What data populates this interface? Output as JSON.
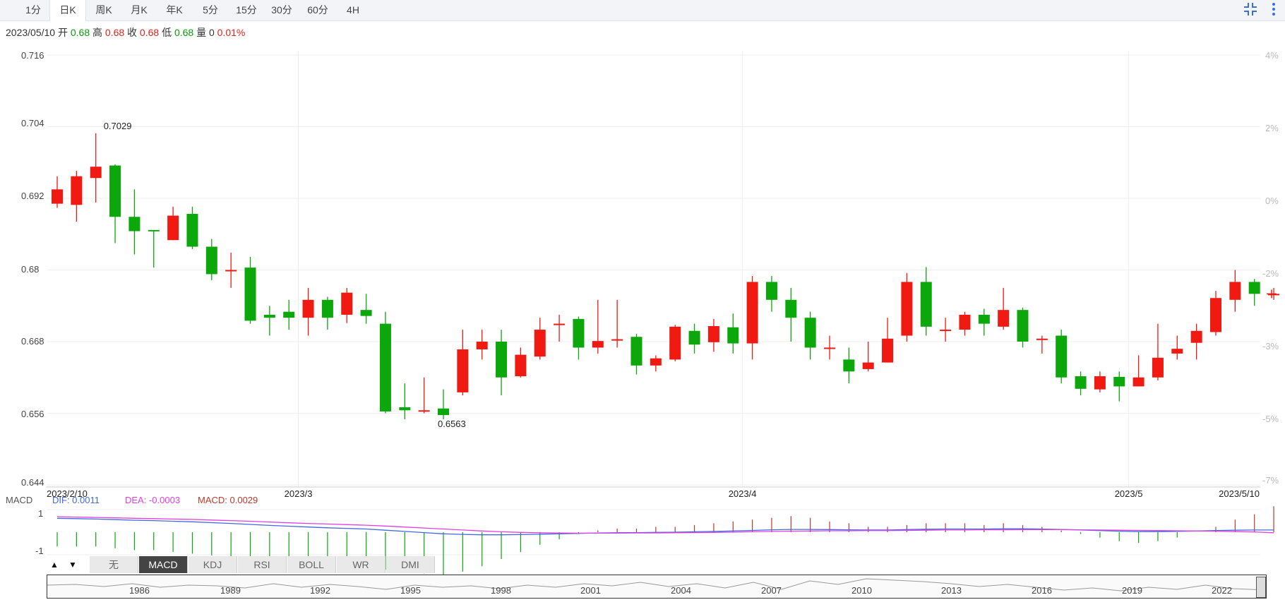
{
  "tabs": [
    "1分",
    "日K",
    "周K",
    "月K",
    "年K",
    "5分",
    "15分",
    "30分",
    "60分",
    "4H"
  ],
  "active_tab": "日K",
  "toolbar_icons": [
    "collapse-icon",
    "more-icon"
  ],
  "ohlc_info": {
    "date": "2023/05/10",
    "open_label": "开",
    "open": "0.68",
    "high_label": "高",
    "high": "0.68",
    "close_label": "收",
    "close": "0.68",
    "low_label": "低",
    "low": "0.68",
    "volume_label": "量",
    "volume": "0",
    "change": "0.01%"
  },
  "colors": {
    "up": "#f01a12",
    "down": "#0ba70b",
    "dif": "#4169e1",
    "dea": "#e040e0",
    "macd": "#c0392b",
    "grid": "#eeeeee"
  },
  "chart_data": {
    "type": "candlestick",
    "y_ticks": [
      "0.716",
      "0.704",
      "0.692",
      "0.68",
      "0.668",
      "0.656",
      "0.644"
    ],
    "pct_ticks": [
      "4%",
      "2%",
      "0%",
      "-2%",
      "-3%",
      "-5%",
      "-7%"
    ],
    "ylim": [
      0.644,
      0.716
    ],
    "x_labels": [
      {
        "index": 0,
        "label": "2023/2/10"
      },
      {
        "index": 13,
        "label": "2023/3"
      },
      {
        "index": 36,
        "label": "2023/4"
      },
      {
        "index": 56,
        "label": "2023/5"
      },
      {
        "index": 63,
        "label": "2023/5/10"
      }
    ],
    "annotations": [
      {
        "index": 2,
        "value": 0.7029,
        "label": "0.7029"
      },
      {
        "index": 20,
        "value": 0.6563,
        "label": "0.6563"
      }
    ],
    "candles": [
      [
        0.6911,
        0.6935,
        0.6957,
        0.6904
      ],
      [
        0.6909,
        0.6957,
        0.6966,
        0.6881
      ],
      [
        0.6954,
        0.6973,
        0.7029,
        0.6913
      ],
      [
        0.6975,
        0.6889,
        0.6977,
        0.6845
      ],
      [
        0.6889,
        0.6865,
        0.6935,
        0.6826
      ],
      [
        0.6867,
        0.6866,
        0.6866,
        0.6804
      ],
      [
        0.685,
        0.6891,
        0.6906,
        0.685
      ],
      [
        0.6894,
        0.6839,
        0.6906,
        0.6835
      ],
      [
        0.6839,
        0.6793,
        0.6852,
        0.6783
      ],
      [
        0.68,
        0.68,
        0.6829,
        0.677
      ],
      [
        0.6804,
        0.6715,
        0.6822,
        0.671
      ],
      [
        0.6725,
        0.672,
        0.674,
        0.669
      ],
      [
        0.673,
        0.672,
        0.675,
        0.67
      ],
      [
        0.672,
        0.675,
        0.677,
        0.669
      ],
      [
        0.675,
        0.672,
        0.6755,
        0.67
      ],
      [
        0.6725,
        0.6762,
        0.677,
        0.6711
      ],
      [
        0.6733,
        0.6723,
        0.676,
        0.671
      ],
      [
        0.671,
        0.6563,
        0.673,
        0.656
      ],
      [
        0.657,
        0.6565,
        0.661,
        0.655
      ],
      [
        0.6565,
        0.6565,
        0.662,
        0.656
      ],
      [
        0.6568,
        0.6557,
        0.66,
        0.655
      ],
      [
        0.6595,
        0.6667,
        0.67,
        0.659
      ],
      [
        0.6667,
        0.668,
        0.67,
        0.665
      ],
      [
        0.668,
        0.662,
        0.67,
        0.659
      ],
      [
        0.6622,
        0.6658,
        0.667,
        0.662
      ],
      [
        0.6655,
        0.67,
        0.672,
        0.665
      ],
      [
        0.671,
        0.671,
        0.6725,
        0.668
      ],
      [
        0.6718,
        0.667,
        0.6722,
        0.665
      ],
      [
        0.667,
        0.6681,
        0.675,
        0.666
      ],
      [
        0.6684,
        0.6684,
        0.675,
        0.667
      ],
      [
        0.6688,
        0.664,
        0.6693,
        0.6625
      ],
      [
        0.664,
        0.6652,
        0.6657,
        0.663
      ],
      [
        0.665,
        0.6705,
        0.6708,
        0.6647
      ],
      [
        0.6698,
        0.6675,
        0.671,
        0.666
      ],
      [
        0.6679,
        0.6706,
        0.6718,
        0.6663
      ],
      [
        0.6704,
        0.6677,
        0.6727,
        0.666
      ],
      [
        0.6677,
        0.678,
        0.679,
        0.665
      ],
      [
        0.678,
        0.675,
        0.679,
        0.673
      ],
      [
        0.675,
        0.672,
        0.677,
        0.668
      ],
      [
        0.672,
        0.667,
        0.673,
        0.665
      ],
      [
        0.667,
        0.667,
        0.669,
        0.665
      ],
      [
        0.665,
        0.663,
        0.667,
        0.661
      ],
      [
        0.6634,
        0.6645,
        0.668,
        0.663
      ],
      [
        0.6645,
        0.6685,
        0.672,
        0.6645
      ],
      [
        0.669,
        0.678,
        0.6795,
        0.668
      ],
      [
        0.678,
        0.6705,
        0.6805,
        0.669
      ],
      [
        0.67,
        0.67,
        0.672,
        0.668
      ],
      [
        0.67,
        0.6725,
        0.673,
        0.669
      ],
      [
        0.6725,
        0.671,
        0.6735,
        0.669
      ],
      [
        0.6705,
        0.6733,
        0.677,
        0.67
      ],
      [
        0.6733,
        0.668,
        0.6737,
        0.667
      ],
      [
        0.6685,
        0.6685,
        0.669,
        0.666
      ],
      [
        0.669,
        0.662,
        0.67,
        0.661
      ],
      [
        0.6622,
        0.6601,
        0.663,
        0.659
      ],
      [
        0.66,
        0.6622,
        0.663,
        0.6595
      ],
      [
        0.6621,
        0.6605,
        0.663,
        0.658
      ],
      [
        0.6605,
        0.662,
        0.6657,
        0.6605
      ],
      [
        0.662,
        0.6653,
        0.671,
        0.6615
      ],
      [
        0.666,
        0.6668,
        0.669,
        0.665
      ],
      [
        0.6678,
        0.6698,
        0.671,
        0.665
      ],
      [
        0.6696,
        0.6753,
        0.6765,
        0.669
      ],
      [
        0.675,
        0.678,
        0.68,
        0.673
      ],
      [
        0.678,
        0.676,
        0.6785,
        0.674
      ],
      [
        0.676,
        0.676,
        0.677,
        0.675
      ]
    ],
    "macd": {
      "dif_label": "DIF: 0.0011",
      "dea_label": "DEA: -0.0003",
      "macd_label": "MACD: 0.0029",
      "title": "MACD",
      "y_ticks": [
        "1",
        "-1"
      ],
      "dif": [
        0.007,
        0.0068,
        0.0066,
        0.0063,
        0.006,
        0.0058,
        0.0055,
        0.0052,
        0.0048,
        0.0044,
        0.0039,
        0.0034,
        0.003,
        0.0026,
        0.0022,
        0.0019,
        0.0016,
        0.001,
        0.0004,
        -0.0002,
        -0.0008,
        -0.0011,
        -0.0013,
        -0.0013,
        -0.0012,
        -0.001,
        -0.0008,
        -0.0006,
        -0.0004,
        -0.0003,
        -0.0002,
        -0.0001,
        0.0,
        0.0002,
        0.0004,
        0.0006,
        0.0009,
        0.0012,
        0.0014,
        0.0014,
        0.0013,
        0.0012,
        0.0011,
        0.0011,
        0.0013,
        0.0015,
        0.0016,
        0.0016,
        0.0016,
        0.0017,
        0.0017,
        0.0016,
        0.0014,
        0.0011,
        0.0008,
        0.0005,
        0.0003,
        0.0003,
        0.0004,
        0.0006,
        0.0008,
        0.001,
        0.0011,
        0.0011
      ],
      "dea": [
        0.0078,
        0.0076,
        0.0074,
        0.0072,
        0.007,
        0.0068,
        0.0066,
        0.0064,
        0.0061,
        0.0058,
        0.0055,
        0.0051,
        0.0047,
        0.0044,
        0.0041,
        0.0038,
        0.0035,
        0.0031,
        0.0026,
        0.0021,
        0.0016,
        0.0011,
        0.0006,
        0.0002,
        -0.0001,
        -0.0003,
        -0.0004,
        -0.0005,
        -0.0005,
        -0.0005,
        -0.0004,
        -0.0004,
        -0.0003,
        -0.0002,
        -0.0001,
        0.0,
        0.0002,
        0.0004,
        0.0005,
        0.0006,
        0.0007,
        0.0007,
        0.0008,
        0.0008,
        0.0009,
        0.001,
        0.0011,
        0.0011,
        0.0012,
        0.0012,
        0.0013,
        0.0013,
        0.0013,
        0.0012,
        0.0011,
        0.001,
        0.0009,
        0.0008,
        0.0007,
        0.0006,
        0.0005,
        0.0003,
        0.0001,
        -0.0003
      ],
      "hist": [
        -0.0016,
        -0.0016,
        -0.0016,
        -0.0018,
        -0.002,
        -0.002,
        -0.0022,
        -0.0024,
        -0.0026,
        -0.0028,
        -0.0032,
        -0.0034,
        -0.0034,
        -0.0036,
        -0.0038,
        -0.0038,
        -0.0038,
        -0.0042,
        -0.0044,
        -0.0046,
        -0.0048,
        -0.0044,
        -0.0038,
        -0.003,
        -0.0022,
        -0.0014,
        -0.0008,
        -0.0002,
        0.0002,
        0.0004,
        0.0004,
        0.0006,
        0.0006,
        0.0008,
        0.001,
        0.0012,
        0.0014,
        0.0016,
        0.0018,
        0.0016,
        0.0012,
        0.001,
        0.0006,
        0.0006,
        0.0008,
        0.001,
        0.001,
        0.001,
        0.0008,
        0.001,
        0.0008,
        0.0006,
        0.0002,
        -0.0002,
        -0.0006,
        -0.001,
        -0.0012,
        -0.001,
        -0.0006,
        0.0,
        0.0006,
        0.0014,
        0.002,
        0.0029
      ]
    }
  },
  "indicator_tabs": [
    "无",
    "MACD",
    "KDJ",
    "RSI",
    "BOLL",
    "WR",
    "DMI"
  ],
  "active_indicator": "MACD",
  "navigator_years": [
    "1986",
    "1989",
    "1992",
    "1995",
    "1998",
    "2001",
    "2004",
    "2007",
    "2010",
    "2013",
    "2016",
    "2019",
    "2022"
  ]
}
